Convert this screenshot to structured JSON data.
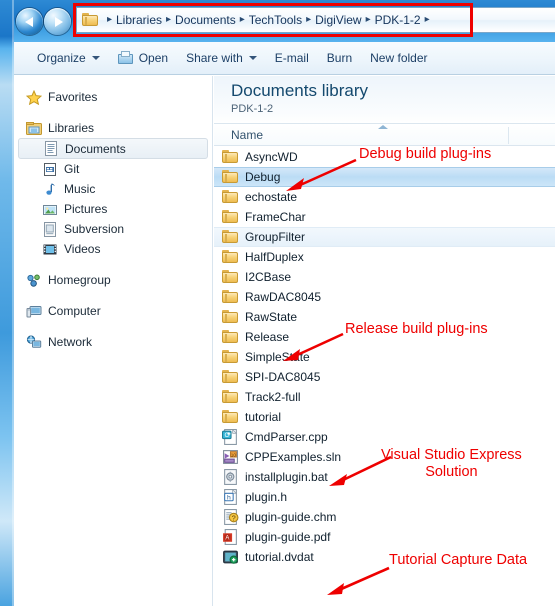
{
  "window": {
    "addressbar": {
      "folder_icon": "folder-icon",
      "crumbs": [
        "Libraries",
        "Documents",
        "TechTools",
        "DigiView",
        "PDK-1-2"
      ],
      "separator": "▸"
    },
    "nav": {
      "back_icon": "back-arrow-icon",
      "forward_icon": "forward-arrow-icon",
      "history_icon": "chevron-down-icon"
    }
  },
  "toolbar": {
    "items": [
      {
        "label": "Organize",
        "caret": true,
        "icon": null
      },
      {
        "label": "Open",
        "caret": false,
        "icon": "open-folder-icon"
      },
      {
        "label": "Share with",
        "caret": true,
        "icon": null
      },
      {
        "label": "E-mail",
        "caret": false,
        "icon": null
      },
      {
        "label": "Burn",
        "caret": false,
        "icon": null
      },
      {
        "label": "New folder",
        "caret": false,
        "icon": null
      }
    ]
  },
  "sidebar": {
    "groups": [
      {
        "items": [
          {
            "label": "Favorites",
            "icon": "star-icon",
            "level": 0,
            "selected": false
          }
        ]
      },
      {
        "items": [
          {
            "label": "Libraries",
            "icon": "libraries-icon",
            "level": 0,
            "selected": false
          },
          {
            "label": "Documents",
            "icon": "documents-icon",
            "level": 1,
            "selected": true
          },
          {
            "label": "Git",
            "icon": "git-library-icon",
            "level": 1,
            "selected": false
          },
          {
            "label": "Music",
            "icon": "music-note-icon",
            "level": 1,
            "selected": false
          },
          {
            "label": "Pictures",
            "icon": "picture-icon",
            "level": 1,
            "selected": false
          },
          {
            "label": "Subversion",
            "icon": "subversion-icon",
            "level": 1,
            "selected": false
          },
          {
            "label": "Videos",
            "icon": "video-film-icon",
            "level": 1,
            "selected": false
          }
        ]
      },
      {
        "items": [
          {
            "label": "Homegroup",
            "icon": "homegroup-icon",
            "level": 0,
            "selected": false
          }
        ]
      },
      {
        "items": [
          {
            "label": "Computer",
            "icon": "computer-icon",
            "level": 0,
            "selected": false
          }
        ]
      },
      {
        "items": [
          {
            "label": "Network",
            "icon": "network-icon",
            "level": 0,
            "selected": false
          }
        ]
      }
    ]
  },
  "main": {
    "library_title": "Documents library",
    "library_subtitle": "PDK-1-2",
    "column_header": "Name",
    "sort_icon": "sort-ascending-icon",
    "files": [
      {
        "name": "AsyncWD",
        "icon": "folder-icon",
        "state": "normal"
      },
      {
        "name": "Debug",
        "icon": "folder-icon",
        "state": "selected"
      },
      {
        "name": "echostate",
        "icon": "folder-icon",
        "state": "normal"
      },
      {
        "name": "FrameChar",
        "icon": "folder-icon",
        "state": "normal"
      },
      {
        "name": "GroupFilter",
        "icon": "folder-icon",
        "state": "hover"
      },
      {
        "name": "HalfDuplex",
        "icon": "folder-icon",
        "state": "normal"
      },
      {
        "name": "I2CBase",
        "icon": "folder-icon",
        "state": "normal"
      },
      {
        "name": "RawDAC8045",
        "icon": "folder-icon",
        "state": "normal"
      },
      {
        "name": "RawState",
        "icon": "folder-icon",
        "state": "normal"
      },
      {
        "name": "Release",
        "icon": "folder-icon",
        "state": "normal"
      },
      {
        "name": "SimpleState",
        "icon": "folder-icon",
        "state": "normal"
      },
      {
        "name": "SPI-DAC8045",
        "icon": "folder-icon",
        "state": "normal"
      },
      {
        "name": "Track2-full",
        "icon": "folder-icon",
        "state": "normal"
      },
      {
        "name": "tutorial",
        "icon": "folder-icon",
        "state": "normal"
      },
      {
        "name": "CmdParser.cpp",
        "icon": "cpp-file-icon",
        "state": "normal"
      },
      {
        "name": "CPPExamples.sln",
        "icon": "vs-solution-icon",
        "state": "normal"
      },
      {
        "name": "installplugin.bat",
        "icon": "bat-script-icon",
        "state": "normal"
      },
      {
        "name": "plugin.h",
        "icon": "header-file-icon",
        "state": "normal"
      },
      {
        "name": "plugin-guide.chm",
        "icon": "chm-help-icon",
        "state": "normal"
      },
      {
        "name": "plugin-guide.pdf",
        "icon": "pdf-file-icon",
        "state": "normal"
      },
      {
        "name": "tutorial.dvdat",
        "icon": "dvdat-file-icon",
        "state": "normal"
      }
    ]
  },
  "annotations": {
    "color": "#ee0000",
    "items": [
      {
        "text": "Debug build plug-ins",
        "target": "Debug"
      },
      {
        "text": "Release build plug-ins",
        "target": "Release"
      },
      {
        "text": "Visual Studio Express\nSolution",
        "target": "CPPExamples.sln"
      },
      {
        "text": "Tutorial Capture Data",
        "target": "tutorial.dvdat"
      }
    ],
    "highlight_box_target": "addressbar"
  }
}
